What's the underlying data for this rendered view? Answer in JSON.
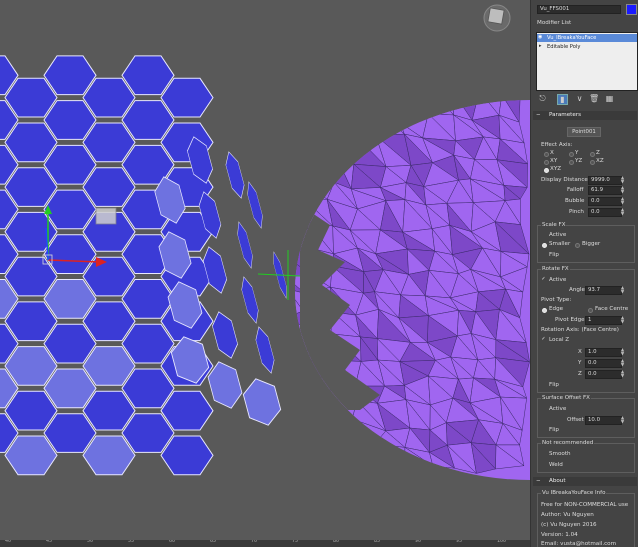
{
  "panel": {
    "object_name": "Vu_FFS001",
    "color_swatch": "#1a1aff",
    "modifier_list_label": "Modifier List",
    "stack": [
      {
        "label": "Vu_IBreakaYouFace",
        "selected": true
      },
      {
        "label": "Editable Poly",
        "selected": false
      }
    ],
    "toolbar_icons": [
      "pin-icon",
      "show-end-result-icon",
      "make-unique-icon",
      "remove-modifier-icon",
      "configure-sets-icon"
    ],
    "parameters": {
      "title": "Parameters",
      "point_button": "Point001",
      "effect_axis_label": "Effect Axis:",
      "axis_options": [
        "X",
        "Y",
        "Z",
        "XY",
        "YZ",
        "XZ",
        "XYZ"
      ],
      "axis_selected": "XYZ",
      "display_distance_label": "Display Distance",
      "display_distance": "9999.0",
      "falloff_label": "Falloff",
      "falloff": "61.9",
      "bubble_label": "Bubble",
      "bubble": "0.0",
      "pinch_label": "Pinch",
      "pinch": "0.0"
    },
    "scale_fx": {
      "title": "Scale FX",
      "active_label": "Active",
      "smaller_label": "Smaller",
      "bigger_label": "Bigger",
      "flip_label": "Flip",
      "selected": "Smaller"
    },
    "rotate_fx": {
      "title": "Rotate FX",
      "active_label": "Active",
      "active": true,
      "angle_label": "Angle",
      "angle": "93.7",
      "pivot_type_label": "Pivot Type:",
      "edge_label": "Edge",
      "face_centre_label": "Face Centre",
      "pivot_edge_label": "Pivot Edge",
      "pivot_edge": "1",
      "rotation_axis_label": "Rotation Axis: (Face Centre)",
      "local_z_label": "Local Z",
      "local_z": true,
      "x_label": "X",
      "x": "1.0",
      "y_label": "Y",
      "y": "0.0",
      "z_label": "Z",
      "z": "0.0",
      "flip_label": "Flip"
    },
    "surface_offset_fx": {
      "title": "Surface Offset FX",
      "active_label": "Active",
      "offset_label": "Offset",
      "offset": "10.0",
      "flip_label": "Flip"
    },
    "not_recommended": {
      "title": "Not recommended",
      "smooth_label": "Smooth",
      "weld_label": "Weld"
    },
    "about": {
      "title": "About",
      "info_title": "Vu IBreakaYouFace Info",
      "license": "Free for NON-COMMERCIAL use",
      "author": "Author: Vu Nguyen",
      "copyright": "(c) Vu Nguyen 2016",
      "version": "Version: 1.04",
      "email": "Email: vusta@hotmail.com"
    }
  },
  "ruler": {
    "ticks": [
      "40",
      "45",
      "50",
      "55",
      "60",
      "65",
      "70",
      "75",
      "80",
      "85",
      "90",
      "95",
      "100"
    ]
  },
  "viewport": {
    "hex_color": "#3b3bd6",
    "hex_light_color": "#6e72e0",
    "sphere_color": "#a066f0",
    "sphere_dark_color": "#7d48c8"
  }
}
